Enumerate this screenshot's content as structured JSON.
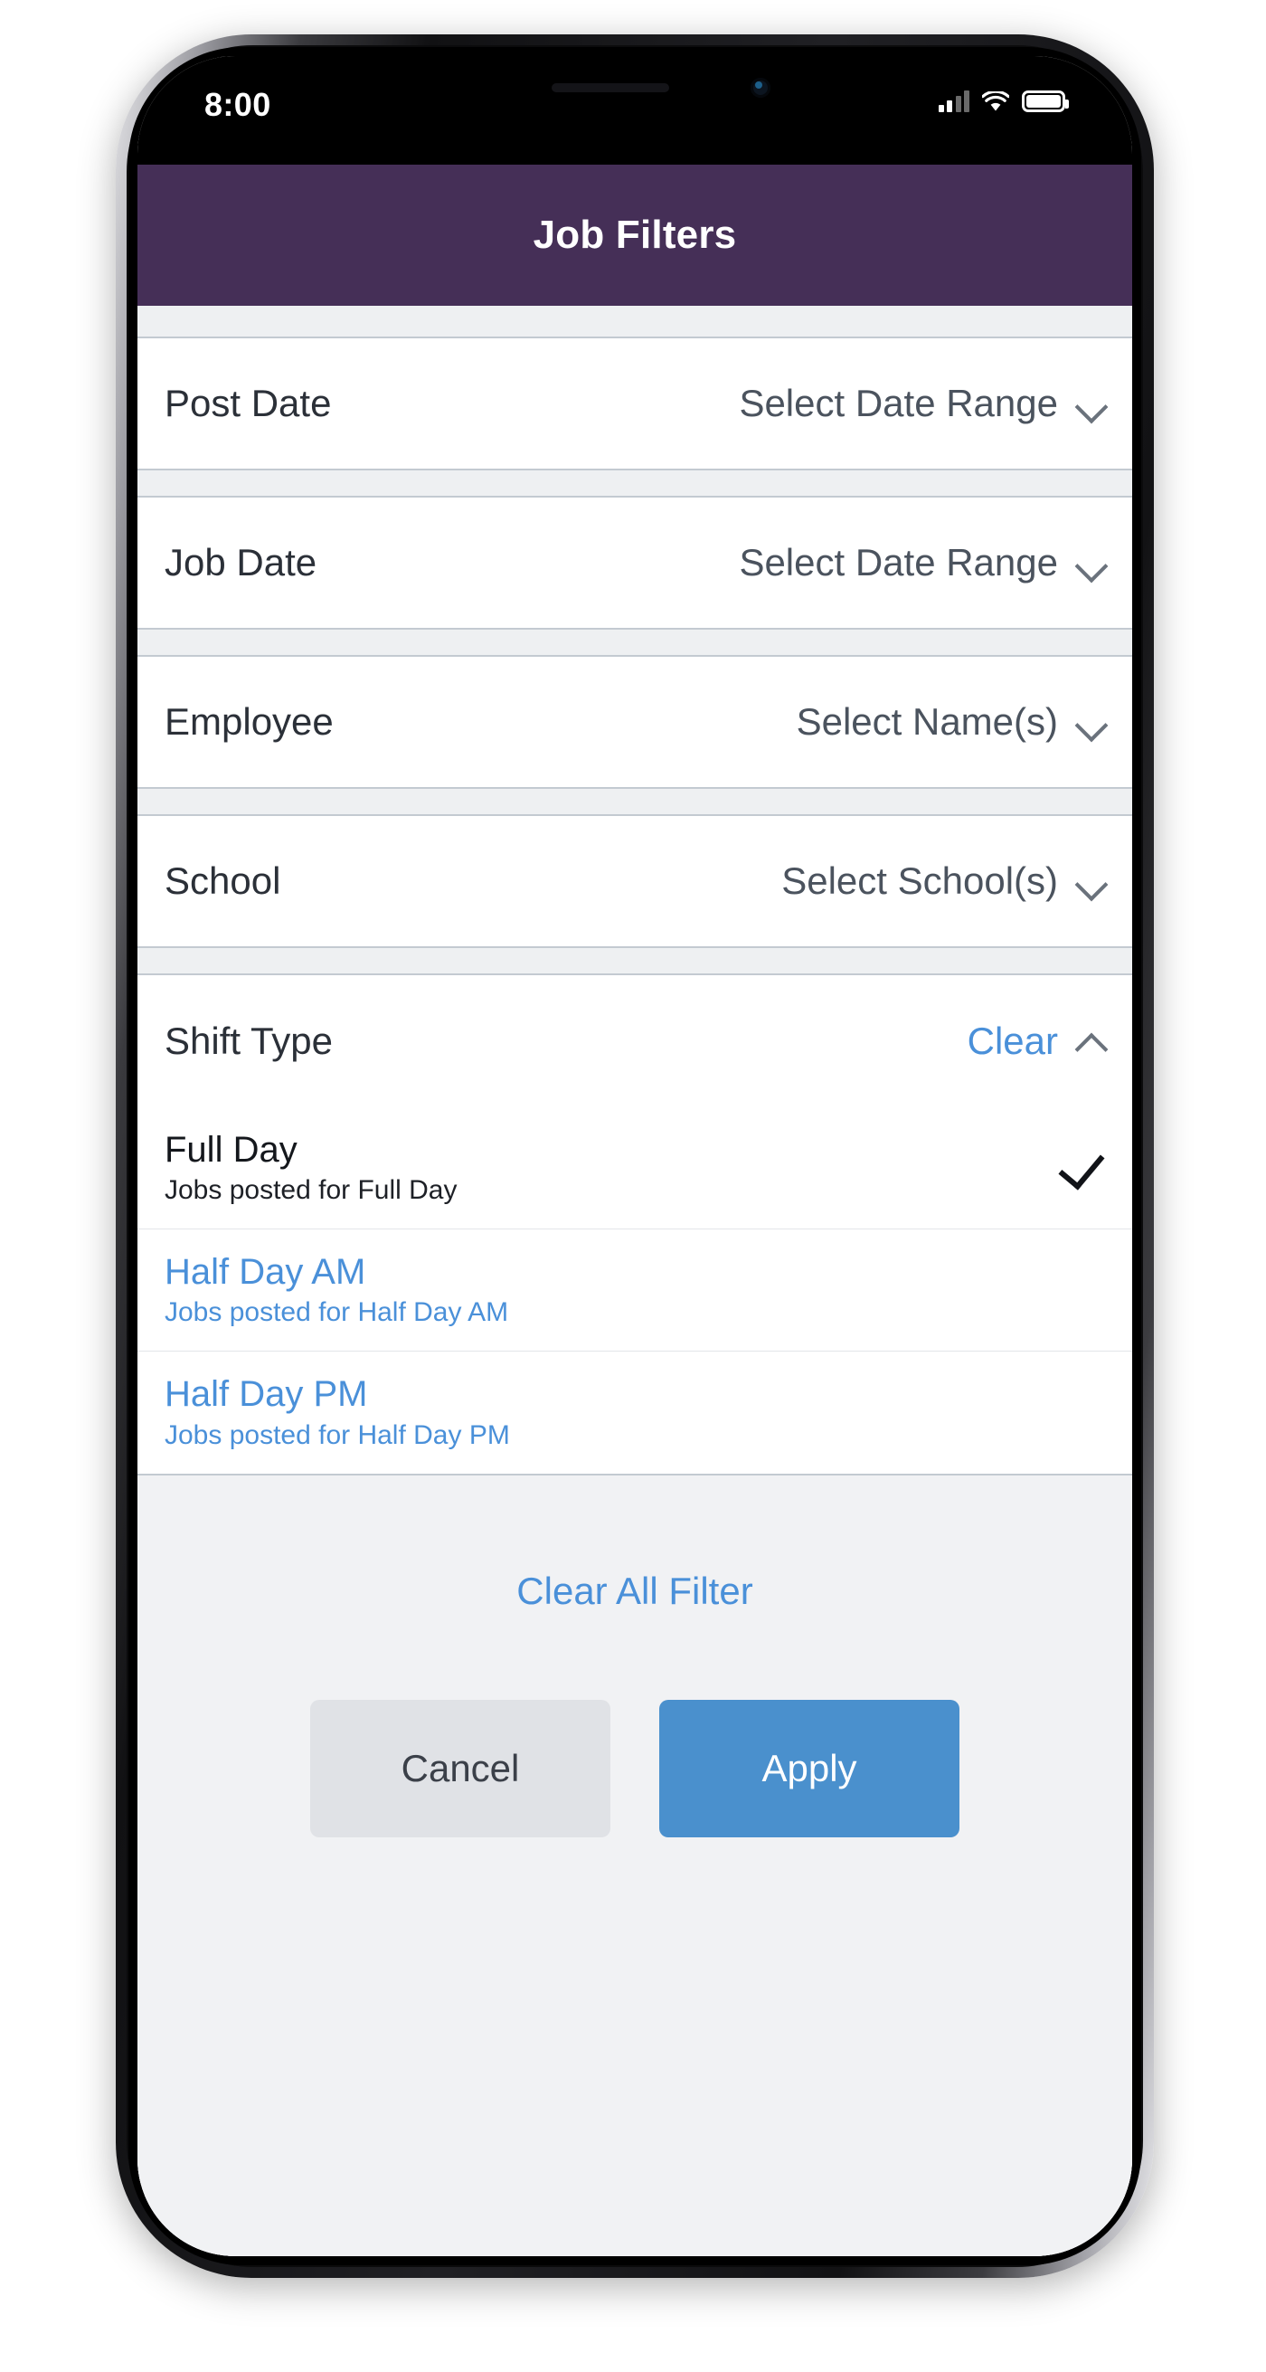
{
  "status_bar": {
    "time": "8:00",
    "signal_icon": "cellular-signal-icon",
    "wifi_icon": "wifi-icon",
    "battery_icon": "battery-full-icon"
  },
  "appbar": {
    "title": "Job Filters"
  },
  "filters": [
    {
      "label": "Post Date",
      "value": "Select Date Range",
      "chevron": "chevron-down-icon",
      "expanded": false
    },
    {
      "label": "Job Date",
      "value": "Select Date Range",
      "chevron": "chevron-down-icon",
      "expanded": false
    },
    {
      "label": "Employee",
      "value": "Select Name(s)",
      "chevron": "chevron-down-icon",
      "expanded": false
    },
    {
      "label": "School",
      "value": "Select School(s)",
      "chevron": "chevron-down-icon",
      "expanded": false
    },
    {
      "label": "Shift Type",
      "value": "Clear",
      "chevron": "chevron-up-icon",
      "expanded": true
    }
  ],
  "shift_type_options": [
    {
      "title": "Full Day",
      "subtitle": "Jobs posted for Full Day",
      "selected": true,
      "check_icon": "check-icon"
    },
    {
      "title": "Half Day AM",
      "subtitle": "Jobs posted for Half Day AM",
      "selected": false,
      "check_icon": ""
    },
    {
      "title": "Half Day PM",
      "subtitle": "Jobs posted for Half Day PM",
      "selected": false,
      "check_icon": ""
    }
  ],
  "footer": {
    "clear_all_label": "Clear All Filter",
    "cancel_label": "Cancel",
    "apply_label": "Apply"
  },
  "colors": {
    "appbar_purple": "#452f57",
    "link_blue": "#4a90d9",
    "apply_blue": "#4a90cd",
    "cancel_grey": "#e0e2e6",
    "page_bg": "#f1f2f4",
    "divider": "#c3cad1"
  }
}
